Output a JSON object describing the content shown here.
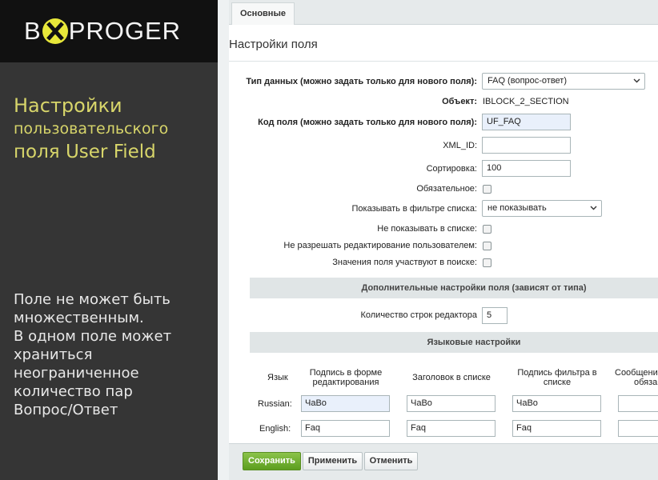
{
  "promo": {
    "logo_left": "B",
    "logo_right": "PROGER",
    "title_lines": [
      "Настройки",
      "пользовательского",
      "поля User Field"
    ],
    "description_lines": [
      "Поле не может быть",
      "множественным.",
      "В одном поле может",
      "храниться",
      "неограниченное",
      "количество пар",
      "Вопрос/Ответ"
    ],
    "accent_color": "#d7d56a",
    "logo_circle_color": "#e8e83a"
  },
  "tabs": [
    {
      "label": "Основные"
    }
  ],
  "form": {
    "title": "Настройки поля",
    "data_type": {
      "label": "Тип данных (можно задать только для нового поля):",
      "value": "FAQ (вопрос-ответ)"
    },
    "object": {
      "label": "Объект:",
      "value": "IBLOCK_2_SECTION"
    },
    "field_code": {
      "label": "Код поля (можно задать только для нового поля):",
      "value": "UF_FAQ"
    },
    "xml_id": {
      "label": "XML_ID:",
      "value": ""
    },
    "sort": {
      "label": "Сортировка:",
      "value": "100"
    },
    "required": {
      "label": "Обязательное:",
      "checked": false
    },
    "show_filter": {
      "label": "Показывать в фильтре списка:",
      "value": "не показывать"
    },
    "hide_in_list": {
      "label": "Не показывать в списке:",
      "checked": false
    },
    "no_user_edit": {
      "label": "Не разрешать редактирование пользователем:",
      "checked": false
    },
    "searchable": {
      "label": "Значения поля участвуют в поиске:",
      "checked": false
    }
  },
  "extra": {
    "heading": "Дополнительные настройки поля (зависят от типа)",
    "editor_rows": {
      "label": "Количество строк редактора",
      "value": "5"
    }
  },
  "languages": {
    "heading": "Языковые настройки",
    "columns": {
      "lang": "Язык",
      "edit_form": [
        "Подпись в форме",
        "редактирования"
      ],
      "list_header": "Заголовок в списке",
      "filter_label": [
        "Подпись фильтра в",
        "списке"
      ],
      "message": [
        "Сообщение",
        "обяза"
      ]
    },
    "rows": [
      {
        "lang": "Russian:",
        "edit_form": "ЧаВо",
        "list_header": "ЧаВо",
        "filter_label": "ЧаВо"
      },
      {
        "lang": "English:",
        "edit_form": "Faq",
        "list_header": "Faq",
        "filter_label": "Faq"
      }
    ]
  },
  "buttons": {
    "save": "Сохранить",
    "apply": "Применить",
    "cancel": "Отменить"
  }
}
